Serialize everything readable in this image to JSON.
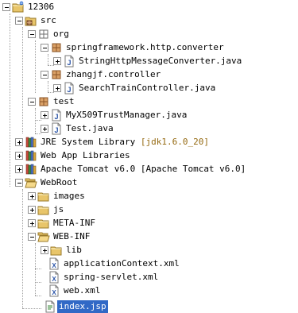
{
  "explorer": {
    "project": "12306",
    "src": {
      "label": "src",
      "org": "org",
      "pkg_converter": "springframework.http.converter",
      "file_converter": "StringHttpMessageConverter.java",
      "pkg_controller": "zhangjf.controller",
      "file_controller": "SearchTrainController.java",
      "test": "test",
      "file_trust": "MyX509TrustManager.java",
      "file_test": "Test.java"
    },
    "jre": {
      "label": "JRE System Library",
      "decoration": "[jdk1.6.0_20]"
    },
    "webapp_libs": "Web App Libraries",
    "tomcat": {
      "label": "Apache Tomcat v6.0",
      "decoration": "[Apache Tomcat v6.0]"
    },
    "webroot": {
      "label": "WebRoot",
      "images": "images",
      "js": "js",
      "meta_inf": "META-INF",
      "web_inf": "WEB-INF",
      "lib": "lib",
      "app_context": "applicationContext.xml",
      "spring_servlet": "spring-servlet.xml",
      "web_xml": "web.xml",
      "index_jsp": "index.jsp"
    },
    "selected_item": "index.jsp"
  },
  "colors": {
    "selection": "#3169c6",
    "folder": "#e8c56a",
    "decoration": "#94680f"
  }
}
